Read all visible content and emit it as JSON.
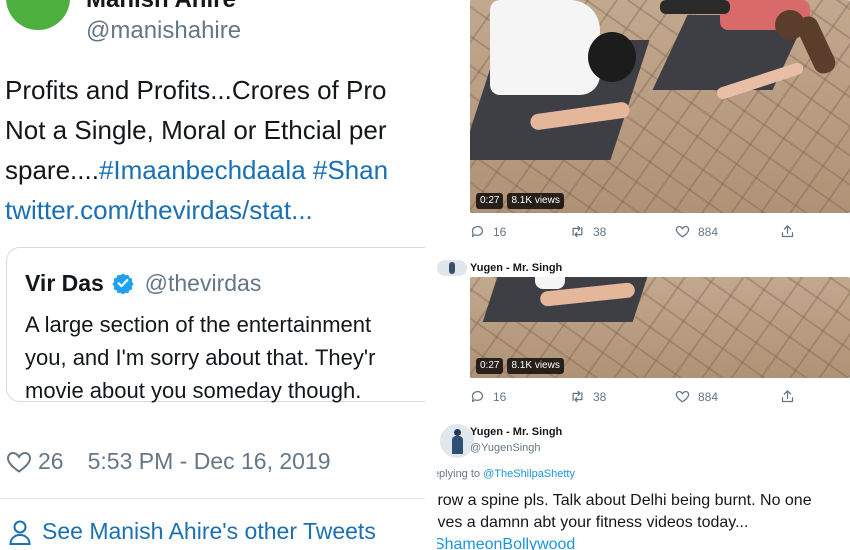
{
  "left_tweet": {
    "author_name": "Manish Ahire",
    "author_handle": "@manishahire",
    "body_lines": [
      "Profits and Profits...Crores of Pro",
      "Not a Single, Moral or Ethcial per",
      "spare....",
      "twitter.com/thevirdas/stat..."
    ],
    "hashtags": [
      "#Imaanbechdaala",
      "#Shan"
    ],
    "quoted": {
      "name": "Vir Das",
      "handle": "@thevirdas",
      "verified_icon": "verified-badge-icon",
      "body_lines": [
        "A large section of the entertainment",
        "you, and I'm sorry about that. They'r",
        "movie about you someday though."
      ]
    },
    "likes": "26",
    "timestamp": "5:53 PM - Dec 16, 2019",
    "other_tweets_link": "See Manish Ahire's other Tweets"
  },
  "right_feed": {
    "video_1": {
      "duration": "0:27",
      "views": "8.1K views"
    },
    "actions_1": {
      "replies": "16",
      "retweets": "38",
      "likes": "884"
    },
    "reply_1_author": "Yugen - Mr. Singh",
    "video_2": {
      "duration": "0:27",
      "views": "8.1K views"
    },
    "actions_2": {
      "replies": "16",
      "retweets": "38",
      "likes": "884"
    },
    "reply_2": {
      "author_name": "Yugen - Mr. Singh",
      "author_handle": "@YugenSingh",
      "replying_to_label": "Replying to",
      "replying_to_handle": "@TheShilpaShetty",
      "body_lines": [
        "Grow a spine pls. Talk about Delhi being burnt. No one",
        "gives a damnn abt your fitness videos today..."
      ],
      "hashtag": "#ShameonBollywood"
    }
  },
  "colors": {
    "link_blue": "#1b6fb4",
    "twitter_blue": "#1b95e0",
    "muted_gray": "#657786",
    "verified_blue": "#1da1f2",
    "avatar_green": "#4caf3e"
  }
}
